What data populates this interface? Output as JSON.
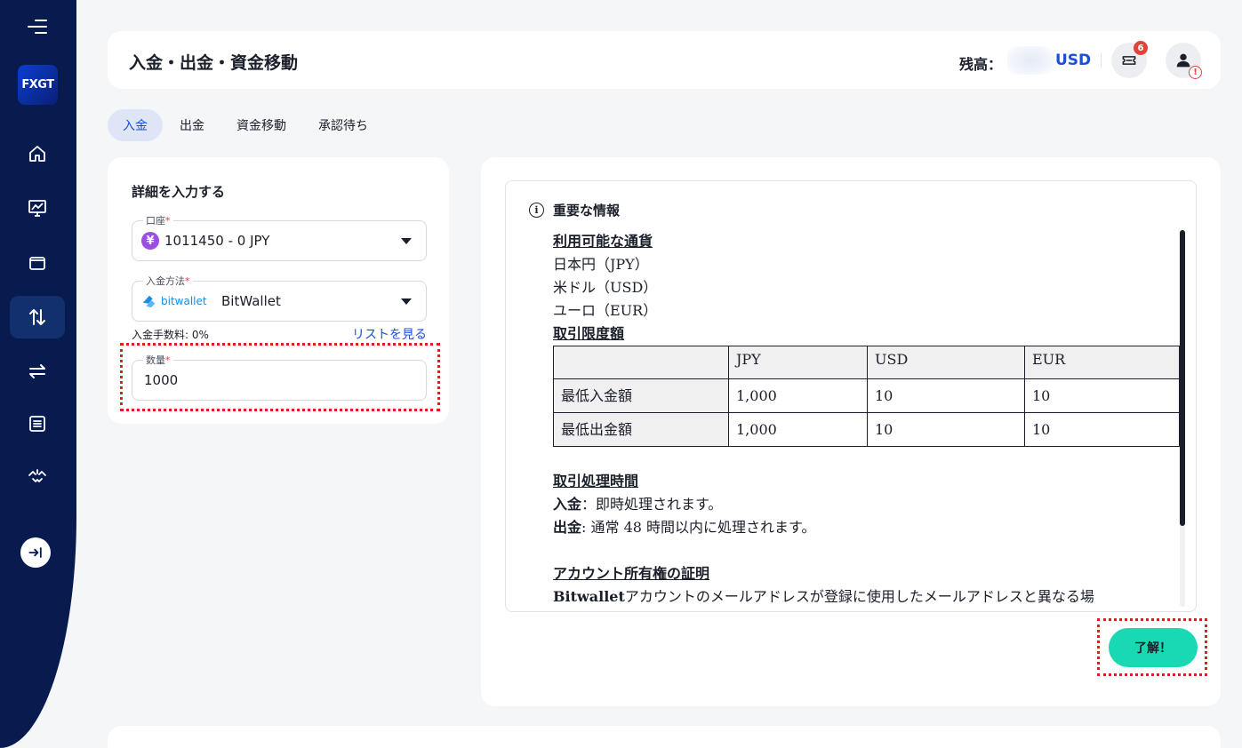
{
  "sidebar": {
    "logo_text": "FXGT",
    "items": [
      {
        "name": "home-icon"
      },
      {
        "name": "chart-monitor-icon"
      },
      {
        "name": "wallet-icon"
      },
      {
        "name": "transfer-arrows-icon",
        "active": true
      },
      {
        "name": "swap-arrows-icon"
      },
      {
        "name": "list-icon"
      },
      {
        "name": "handshake-icon"
      }
    ]
  },
  "header": {
    "title": "入金・出金・資金移動",
    "balance_label": "残高：",
    "balance_currency": "USD",
    "notification_count": "6",
    "alert_symbol": "!"
  },
  "tabs": [
    {
      "label": "入金",
      "active": true
    },
    {
      "label": "出金"
    },
    {
      "label": "資金移動"
    },
    {
      "label": "承認待ち"
    }
  ],
  "form": {
    "title": "詳細を入力する",
    "account": {
      "label": "口座",
      "value": "1011450 - 0 JPY",
      "icon_char": "¥"
    },
    "method": {
      "label": "入金方法",
      "brand": "bitwallet",
      "value": "BitWallet"
    },
    "fee_text": "入金手数料: 0%",
    "list_link": "リストを見る",
    "amount": {
      "label": "数量",
      "value": "1000"
    },
    "required_mark": "*"
  },
  "info": {
    "title": "重要な情報",
    "icon_char": "i",
    "currencies_title": "利用可能な通貨",
    "currencies": [
      "日本円（JPY）",
      "米ドル（USD）",
      "ユーロ（EUR）"
    ],
    "limits_title": "取引限度額",
    "table": {
      "headers": [
        "",
        "JPY",
        "USD",
        "EUR"
      ],
      "rows": [
        [
          "最低入金額",
          "1,000",
          "10",
          "10"
        ],
        [
          "最低出金額",
          "1,000",
          "10",
          "10"
        ]
      ]
    },
    "processing_title": "取引処理時間",
    "deposit_label": "入金",
    "deposit_text": "：即時処理されます。",
    "withdraw_label": "出金",
    "withdraw_text": ": 通常 48 時間以内に処理されます。",
    "ownership_title": "アカウント所有権の証明",
    "ownership_brand": "Bitwallet",
    "ownership_text": "アカウントのメールアドレスが登録に使用したメールアドレスと異なる場"
  },
  "ok_button": "了解！"
}
